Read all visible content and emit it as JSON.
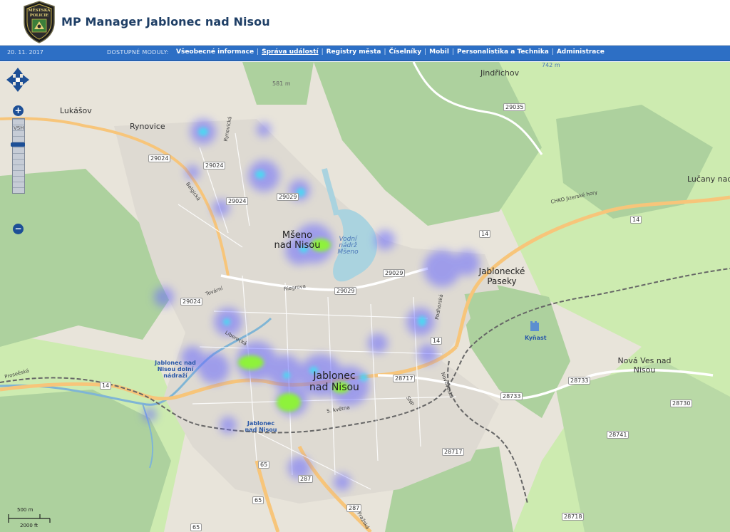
{
  "header": {
    "title": "MP Manager Jablonec nad Nisou",
    "logo_icon": "police-badge-icon",
    "logo_text": [
      "MĚSTSKÁ",
      "POLICIE"
    ]
  },
  "navbar": {
    "date": "20. 11. 2017",
    "modules_label": "DOSTUPNÉ MODULY:",
    "items": [
      {
        "label": "Všeobecné informace",
        "active": false
      },
      {
        "label": "Správa událostí",
        "active": true
      },
      {
        "label": "Registry města",
        "active": false
      },
      {
        "label": "Číselníky",
        "active": false
      },
      {
        "label": "Mobil",
        "active": false
      },
      {
        "label": "Personalistika a Technika",
        "active": false
      },
      {
        "label": "Administrace",
        "active": false
      }
    ],
    "separator": "|"
  },
  "map": {
    "zoom_level": "VSH",
    "scale": {
      "metric": "500 m",
      "imperial": "2000 ft"
    },
    "places": {
      "lukasov": "Lukášov",
      "rynovice": "Rynovice",
      "jindrichov": "Jindřichov",
      "lucany": "Lučany nad Nisou",
      "mseno": "Mšeno nad Nisou",
      "jablonecke_paseky": "Jablonecké Paseky",
      "jablonec": "Jablonec nad Nisou",
      "nova_ves": "Nová Ves nad Nisou",
      "kynast": "Kyňast"
    },
    "water": {
      "nadrz": "Vodní nádrž Mšeno"
    },
    "stations": {
      "dolni": "Jablonec nad Nisou dolní nádraží",
      "hlavni": "Jablonec nad Nisou"
    },
    "elevations": {
      "e581": "581 m",
      "e742": "742 m"
    },
    "roads": {
      "r29024a": "29024",
      "r29024b": "29024",
      "r29024c": "29024",
      "r29024d": "29024",
      "r29029a": "29029",
      "r29029b": "29029",
      "r29029c": "29029",
      "r29035": "29035",
      "r14a": "14",
      "r14b": "14",
      "r14c": "14",
      "r14d": "14",
      "r28717a": "28717",
      "r28717b": "28717",
      "r28733a": "28733",
      "r28733b": "28733",
      "r28730": "28730",
      "r28741": "28741",
      "r28718": "28718",
      "r65a": "65",
      "r65b": "65",
      "r65c": "65",
      "r287a": "287",
      "r287b": "287"
    },
    "streets": {
      "belgicka": "Belgická",
      "rynovicka": "Rynovická",
      "tovarni": "Tovární",
      "riegrova": "Riegrova",
      "liberecka": "Liberecká",
      "podhorska": "Podhorská",
      "novoveska": "Novoveská",
      "proseeska": "Proseěská",
      "kvetna": "5. května",
      "snp": "SNP",
      "prazska": "Pražská",
      "chko": "CHKO Jizerské hory"
    },
    "colors": {
      "land": "#eae6de",
      "forest": "#add19e",
      "meadow": "#cdebb0",
      "water": "#aad3df",
      "urban": "#dcd8d0",
      "main_road": "#f7c57a",
      "rail": "#666666",
      "heat_low": "#6b6bff",
      "heat_mid": "#4fd6f2",
      "heat_high": "#8ef23a"
    }
  }
}
